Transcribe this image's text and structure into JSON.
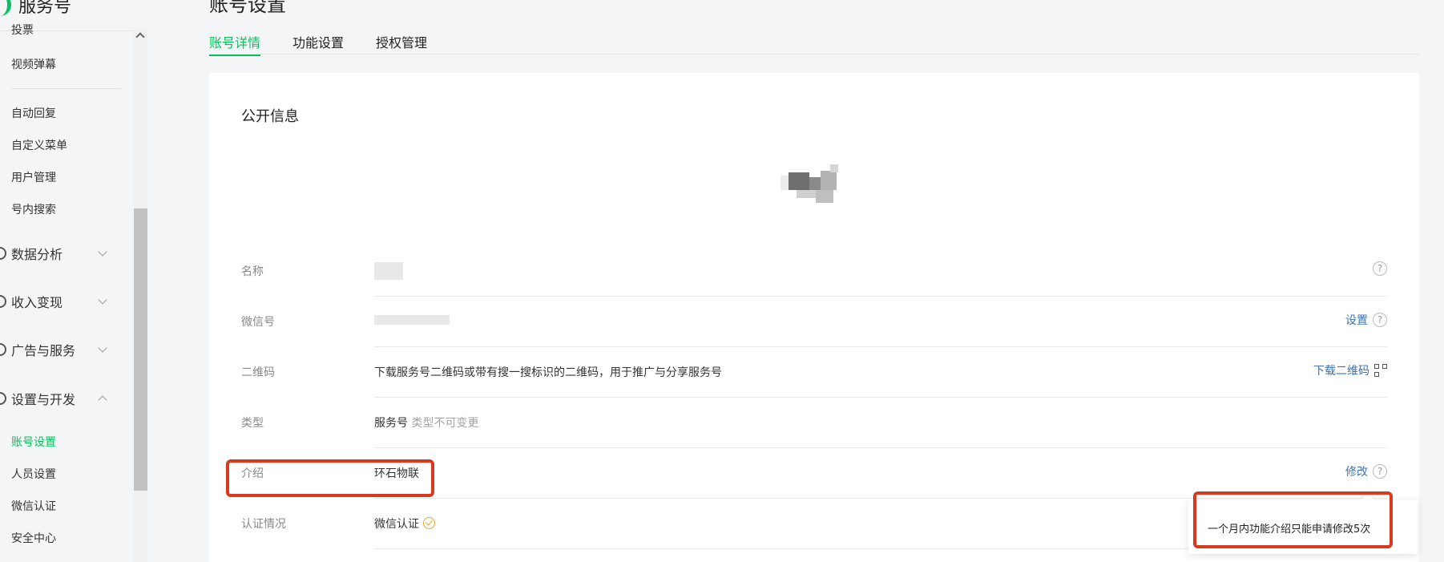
{
  "brand": {
    "name": "服务号"
  },
  "sidebar": {
    "items_top": [
      {
        "label": "投票"
      },
      {
        "label": "视频弹幕"
      }
    ],
    "items_mid": [
      {
        "label": "自动回复"
      },
      {
        "label": "自定义菜单"
      },
      {
        "label": "用户管理"
      },
      {
        "label": "号内搜索"
      }
    ],
    "groups": [
      {
        "label": "数据分析"
      },
      {
        "label": "收入变现"
      },
      {
        "label": "广告与服务"
      },
      {
        "label": "设置与开发"
      }
    ],
    "sub_items": [
      {
        "label": "账号设置"
      },
      {
        "label": "人员设置"
      },
      {
        "label": "微信认证"
      },
      {
        "label": "安全中心"
      }
    ]
  },
  "main": {
    "page_title": "账号设置",
    "tabs": [
      {
        "label": "账号详情"
      },
      {
        "label": "功能设置"
      },
      {
        "label": "授权管理"
      }
    ],
    "section_title": "公开信息",
    "rows": {
      "name": {
        "label": "名称"
      },
      "wechat_id": {
        "label": "微信号",
        "action": "设置"
      },
      "qrcode": {
        "label": "二维码",
        "value": "下载服务号二维码或带有搜一搜标识的二维码，用于推广与分享服务号",
        "action": "下载二维码"
      },
      "type": {
        "label": "类型",
        "value": "服务号",
        "note": "类型不可变更"
      },
      "intro": {
        "label": "介绍",
        "value": "环石物联",
        "action": "修改"
      },
      "verification": {
        "label": "认证情况",
        "value": "微信认证"
      }
    },
    "help_glyph": "?",
    "tooltip": "一个月内功能介绍只能申请修改5次"
  },
  "colors": {
    "accent": "#07c160",
    "link": "#3f72af",
    "highlight": "#d63a1f",
    "verified": "#f0a22a"
  },
  "icons": [
    "brand-logo-icon",
    "chevron-down-icon",
    "chevron-up-icon",
    "help-icon",
    "qrcode-icon",
    "verified-icon"
  ]
}
